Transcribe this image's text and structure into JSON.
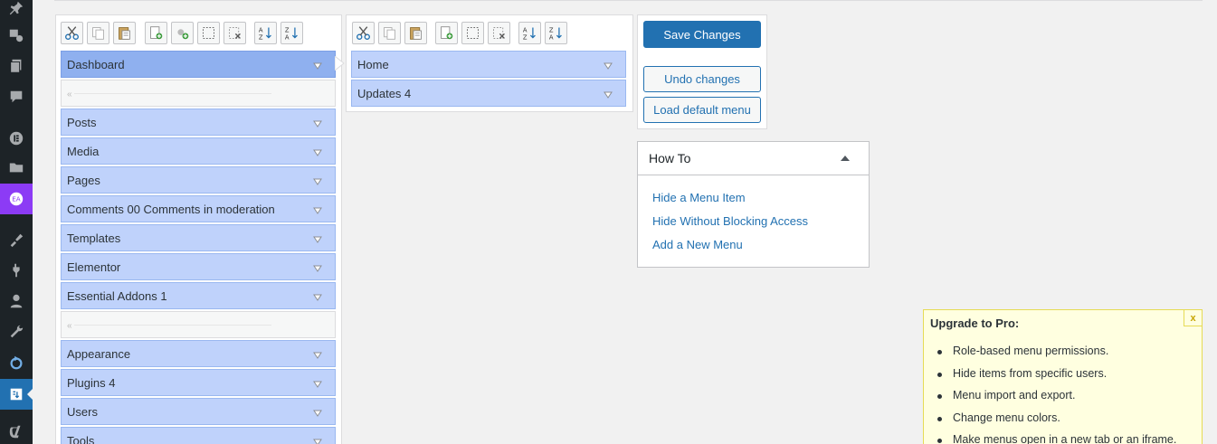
{
  "colors": {
    "sidebar_bg": "#1d2327",
    "accent": "#2271b1",
    "item_bg": "#bfd2fb",
    "selected_item_bg": "#8fb0ef",
    "notice_bg": "#ffffe0"
  },
  "admin_icons": [
    "pin-icon",
    "media-icon",
    "pages-icon",
    "comments-icon",
    "elementor-icon",
    "templates-icon",
    "essential-addons-icon",
    "appearance-icon",
    "plugins-icon",
    "users-icon",
    "tools-icon",
    "sync-icon",
    "menu-editor-icon",
    "yoast-icon"
  ],
  "toolbar": {
    "buttons": [
      "cut-icon",
      "copy-icon",
      "paste-icon",
      "new-menu-icon",
      "new-separator-icon",
      "hide-icon",
      "delete-icon",
      "sort-ascending-icon",
      "sort-descending-icon"
    ]
  },
  "column1": {
    "items": [
      {
        "label": "Dashboard"
      },
      {
        "label": "Posts"
      },
      {
        "label": "Media"
      },
      {
        "label": "Pages"
      },
      {
        "label": "Comments 00 Comments in moderation"
      },
      {
        "label": "Templates"
      },
      {
        "label": "Elementor"
      },
      {
        "label": "Essential Addons 1"
      },
      {
        "label": "Appearance"
      },
      {
        "label": "Plugins 4"
      },
      {
        "label": "Users"
      },
      {
        "label": "Tools"
      }
    ]
  },
  "column2": {
    "items": [
      {
        "label": "Home"
      },
      {
        "label": "Updates 4"
      }
    ]
  },
  "actions": {
    "save": "Save Changes",
    "undo": "Undo changes",
    "load_default": "Load default menu"
  },
  "howto": {
    "title": "How To",
    "links": [
      "Hide a Menu Item",
      "Hide Without Blocking Access",
      "Add a New Menu"
    ]
  },
  "upgrade": {
    "title": "Upgrade to Pro:",
    "close": "x",
    "features": [
      "Role-based menu permissions.",
      "Hide items from specific users.",
      "Menu import and export.",
      "Change menu colors.",
      "Make menus open in a new tab or an iframe."
    ]
  }
}
